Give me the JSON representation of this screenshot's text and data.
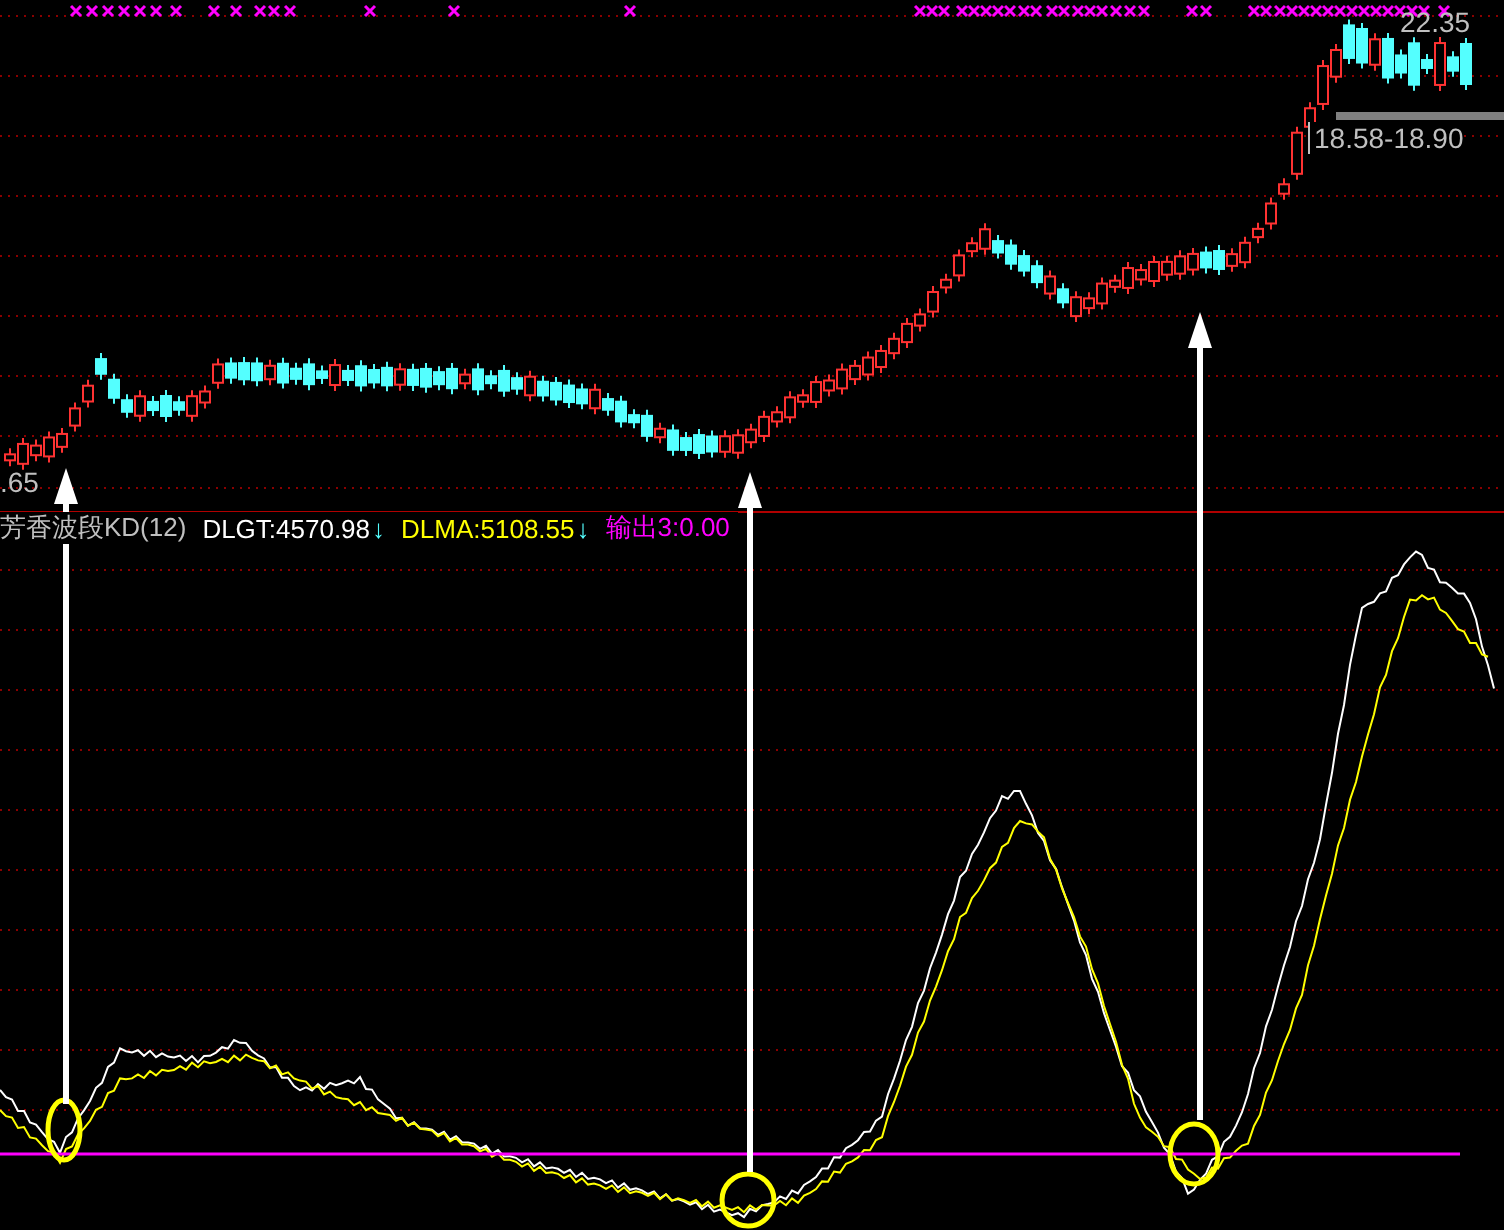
{
  "price_panel": {
    "high_label": "22.35",
    "range_label": "18.58-18.90",
    "low_label": ".65"
  },
  "indicator_name": {
    "text": "芳香波段KD(12)",
    "color": "#c0c0c0"
  },
  "indicator_values": [
    {
      "text": "DLGT:4570.98",
      "color": "#ffffff",
      "trend": "↓"
    },
    {
      "text": "DLMA:5108.55",
      "color": "#ffff00",
      "trend": "↓"
    },
    {
      "text": "输出3:0.00",
      "color": "#ff00ff"
    }
  ]
}
